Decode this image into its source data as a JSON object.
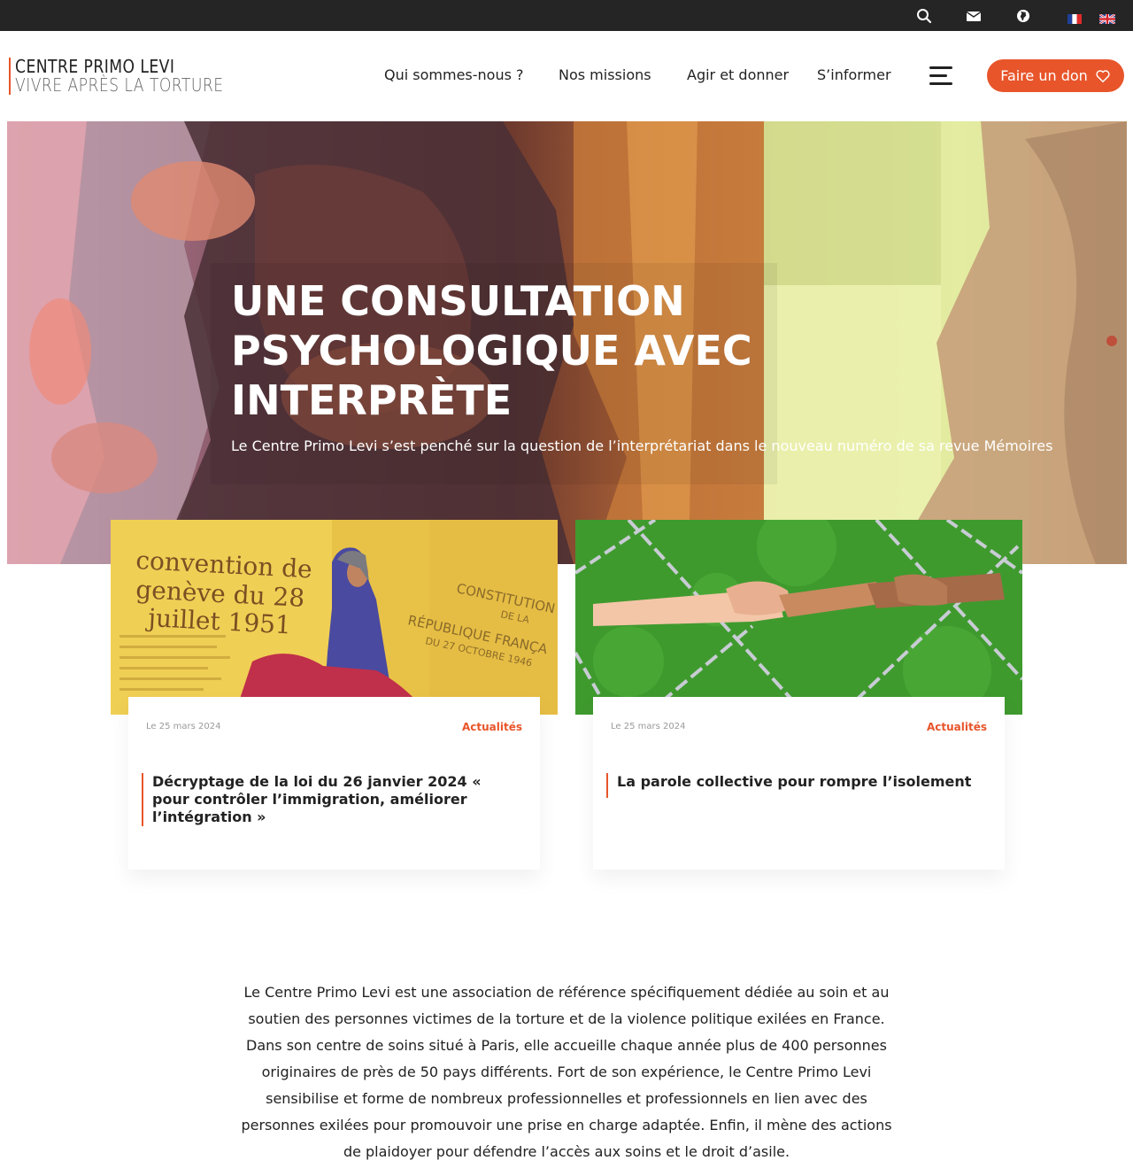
{
  "topbar": {
    "icons": [
      "search-icon",
      "mail-icon",
      "globe-icon"
    ],
    "languages": [
      "fr",
      "en"
    ]
  },
  "brand": {
    "line1": "CENTRE PRIMO LEVI",
    "line2": "VIVRE APRÈS LA TORTURE",
    "accent": "#e8552a"
  },
  "nav": {
    "items": [
      {
        "label": "Qui sommes-nous ?"
      },
      {
        "label": "Nos missions"
      },
      {
        "label": "Agir et donner"
      },
      {
        "label": "S’informer"
      }
    ],
    "menu_icon": "hamburger-icon",
    "donate_label": "Faire un don",
    "donate_icon": "heart-icon"
  },
  "hero": {
    "title": "UNE CONSULTATION PSYCHOLOGIQUE AVEC INTERPRÈTE",
    "subtitle": "Le Centre Primo Levi s’est penché sur la question de l’interprétariat dans le nouveau numéro de sa revue Mémoires"
  },
  "cards": [
    {
      "date": "Le 25 mars 2024",
      "category": "Actualités",
      "title": "Décryptage de la loi du 26 janvier 2024 « pour contrôler l’immigration, améliorer l’intégration »",
      "image_text": {
        "left1": "convention de",
        "left2": "genève du 28",
        "left3": "juillet 1951",
        "right1": "CONSTITUTION",
        "right2": "DE LA",
        "right3": "RÉPUBLIQUE FRANÇA",
        "right4": "DU 27 OCTOBRE 1946"
      }
    },
    {
      "date": "Le 25 mars 2024",
      "category": "Actualités",
      "title": "La parole collective pour rompre l’isolement"
    }
  ],
  "intro": {
    "text": "Le Centre Primo Levi est une association de référence spécifiquement dédiée au soin et au soutien des personnes victimes de la torture et de la violence politique exilées en France. Dans son centre de soins situé à Paris, elle accueille chaque année plus de 400 personnes originaires de près de 50 pays différents. Fort de son expérience, le Centre Primo Levi sensibilise et forme de nombreux professionnelles et professionnels en lien avec des personnes exilées pour promouvoir une prise en charge adaptée. Enfin, il mène des actions de plaidoyer pour défendre l’accès aux soins et le droit d’asile."
  }
}
